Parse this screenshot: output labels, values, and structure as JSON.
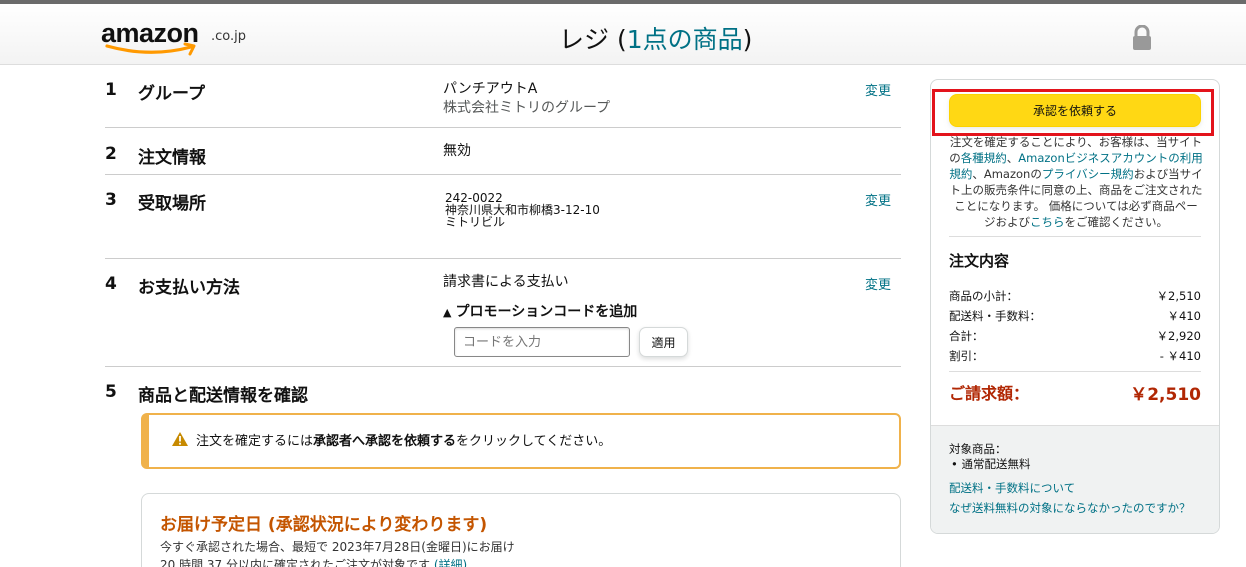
{
  "header": {
    "logo_text": "amazon",
    "logo_tld": ".co.jp",
    "title_prefix": "レジ (",
    "title_count": "1点の商品",
    "title_suffix": ")"
  },
  "steps": [
    {
      "num": "1",
      "title": "グループ",
      "value": "パンチアウトA",
      "sub": "株式会社ミトリのグループ",
      "change": "変更"
    },
    {
      "num": "2",
      "title": "注文情報",
      "value": "無効"
    },
    {
      "num": "3",
      "title": "受取場所",
      "address": [
        "242-0022",
        "神奈川県大和市柳橋3-12-10",
        "ミトリビル"
      ],
      "change": "変更"
    },
    {
      "num": "4",
      "title": "お支払い方法",
      "value": "請求書による支払い",
      "change": "変更",
      "promo_toggle": "プロモーションコードを追加",
      "promo_placeholder": "コードを入力",
      "apply": "適用"
    },
    {
      "num": "5",
      "title": "商品と配送情報を確認"
    }
  ],
  "alert": {
    "pre": "注文を確定するには",
    "bold": "承認者へ承認を依頼する",
    "post": "をクリックしてください。"
  },
  "delivery": {
    "title": "お届け予定日 (承認状況により変わります)",
    "line1": "今すぐ承認された場合、最短で 2023年7月28日(金曜日)にお届け",
    "line2": "20 時間 37 分以内に確定されたご注文が対象です",
    "line2_link": "(詳細)"
  },
  "summary": {
    "button": "承認を依頼する",
    "terms_1": "注文を確定することにより、お客様は、当サイトの",
    "terms_link1": "各種規約",
    "terms_2": "、",
    "terms_link2": "Amazonビジネスアカウントの利用規約",
    "terms_3": "、Amazonの",
    "terms_link3": "プライバシー規約",
    "terms_4": "および当サイト上の販売条件に同意の上、商品をご注文されたことになります。 価格については必ず商品ページおよび",
    "terms_link4": "こちら",
    "terms_5": "をご確認ください。",
    "title": "注文内容",
    "rows": [
      {
        "label": "商品の小計：",
        "amount": "￥2,510"
      },
      {
        "label": "配送料・手数料：",
        "amount": "￥410"
      },
      {
        "label": "合計：",
        "amount": "￥2,920"
      },
      {
        "label": "割引：",
        "amount": "- ￥410"
      }
    ],
    "total_label": "ご請求額：",
    "total_amount": "￥2,510",
    "foot_label": "対象商品：",
    "foot_bullet": "通常配送無料",
    "foot_link1": "配送料・手数料について",
    "foot_link2": "なぜ送料無料の対象にならなかったのですか？"
  },
  "colors": {
    "link": "#007185",
    "button": "#ffd814",
    "highlight": "#e3131b",
    "total": "#b12704",
    "delivery_title": "#c45500",
    "alert_border": "#f0b24b"
  }
}
